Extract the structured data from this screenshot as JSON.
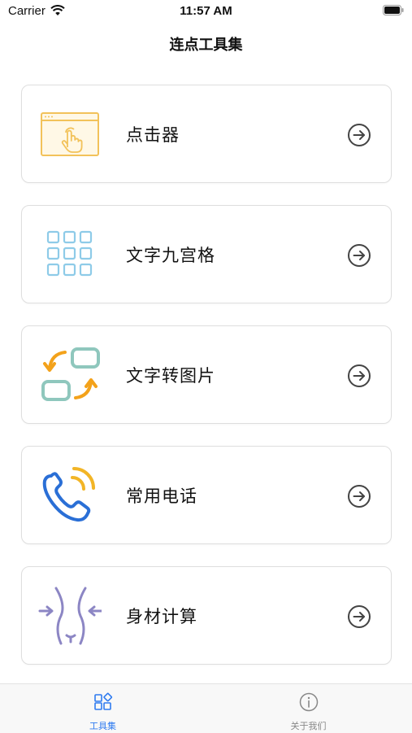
{
  "status_bar": {
    "carrier": "Carrier",
    "time": "11:57 AM"
  },
  "nav": {
    "title": "连点工具集"
  },
  "tools": [
    {
      "label": "点击器",
      "icon": "click-window-icon"
    },
    {
      "label": "文字九宫格",
      "icon": "grid-icon"
    },
    {
      "label": "文字转图片",
      "icon": "swap-icon"
    },
    {
      "label": "常用电话",
      "icon": "phone-icon"
    },
    {
      "label": "身材计算",
      "icon": "body-icon"
    }
  ],
  "tab_bar": {
    "tabs": [
      {
        "label": "工具集",
        "icon": "grid-tab-icon",
        "active": true
      },
      {
        "label": "关于我们",
        "icon": "info-icon",
        "active": false
      }
    ]
  },
  "colors": {
    "accent": "#2f7bf0",
    "click_icon": "#f2c25a",
    "grid_icon": "#8ecbe8",
    "swap_teal": "#8fc7bd",
    "swap_orange": "#f3a21b",
    "phone_blue": "#2a6fd6",
    "phone_yellow": "#f2b526",
    "body_purple": "#8c86c4"
  }
}
